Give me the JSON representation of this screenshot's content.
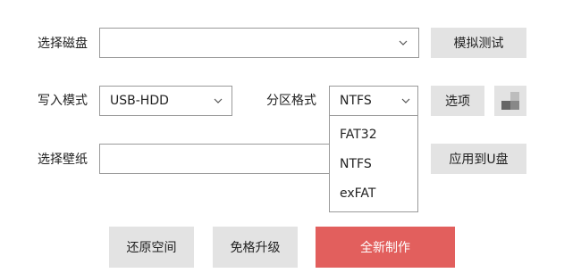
{
  "disk": {
    "label": "选择磁盘",
    "value": "",
    "test_button": "模拟测试"
  },
  "write_mode": {
    "label": "写入模式",
    "value": "USB-HDD"
  },
  "partition": {
    "label": "分区格式",
    "value": "NTFS",
    "options": [
      "FAT32",
      "NTFS",
      "exFAT"
    ]
  },
  "options_button": "选项",
  "wallpaper": {
    "label": "选择壁纸",
    "value": "",
    "apply_button": "应用到U盘"
  },
  "actions": {
    "restore": "还原空间",
    "upgrade": "免格升级",
    "create": "全新制作"
  },
  "colors": {
    "primary": "#e25f5d",
    "button_bg": "#e3e3e3",
    "border": "#9a9a9a"
  },
  "icons": {
    "dropdown": "chevron-down-icon",
    "toggle": "checker-icon"
  }
}
